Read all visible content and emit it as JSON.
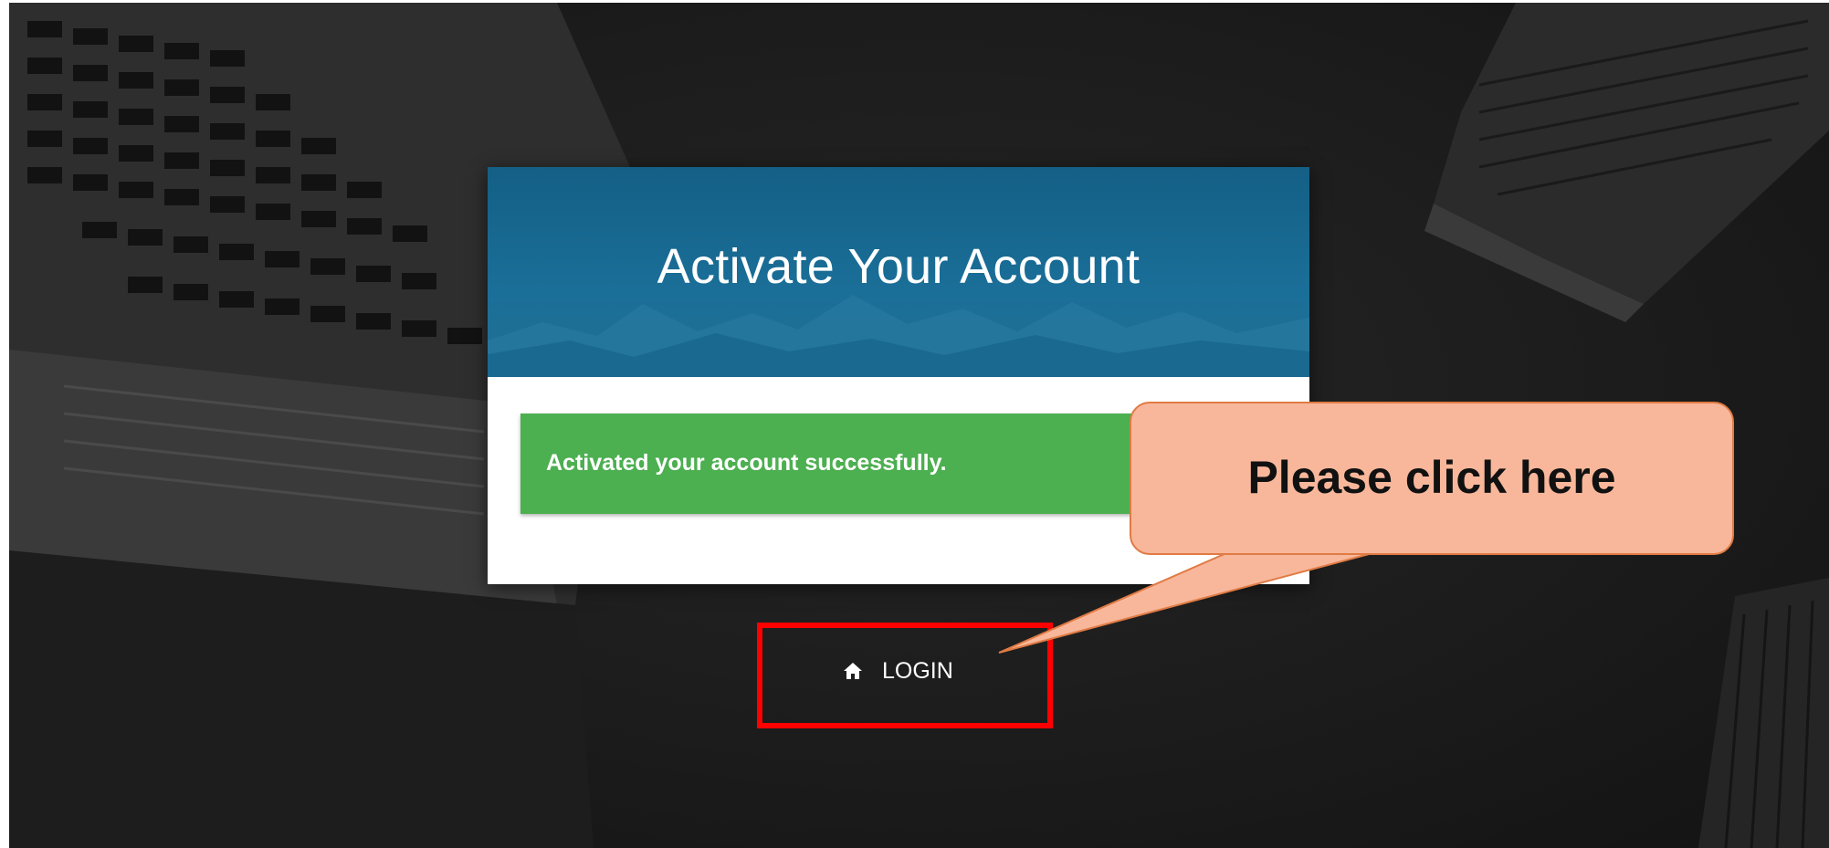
{
  "card": {
    "title": "Activate Your Account",
    "alert_message": "Activated your account successfully."
  },
  "login": {
    "label": "LOGIN",
    "icon": "home-icon"
  },
  "annotation": {
    "callout_text": "Please click here",
    "highlight_color": "#ff0000",
    "callout_fill": "#f8b79b"
  },
  "colors": {
    "header_blue": "#1a6f98",
    "alert_green": "#4caf50",
    "background": "#1c1c1c"
  }
}
